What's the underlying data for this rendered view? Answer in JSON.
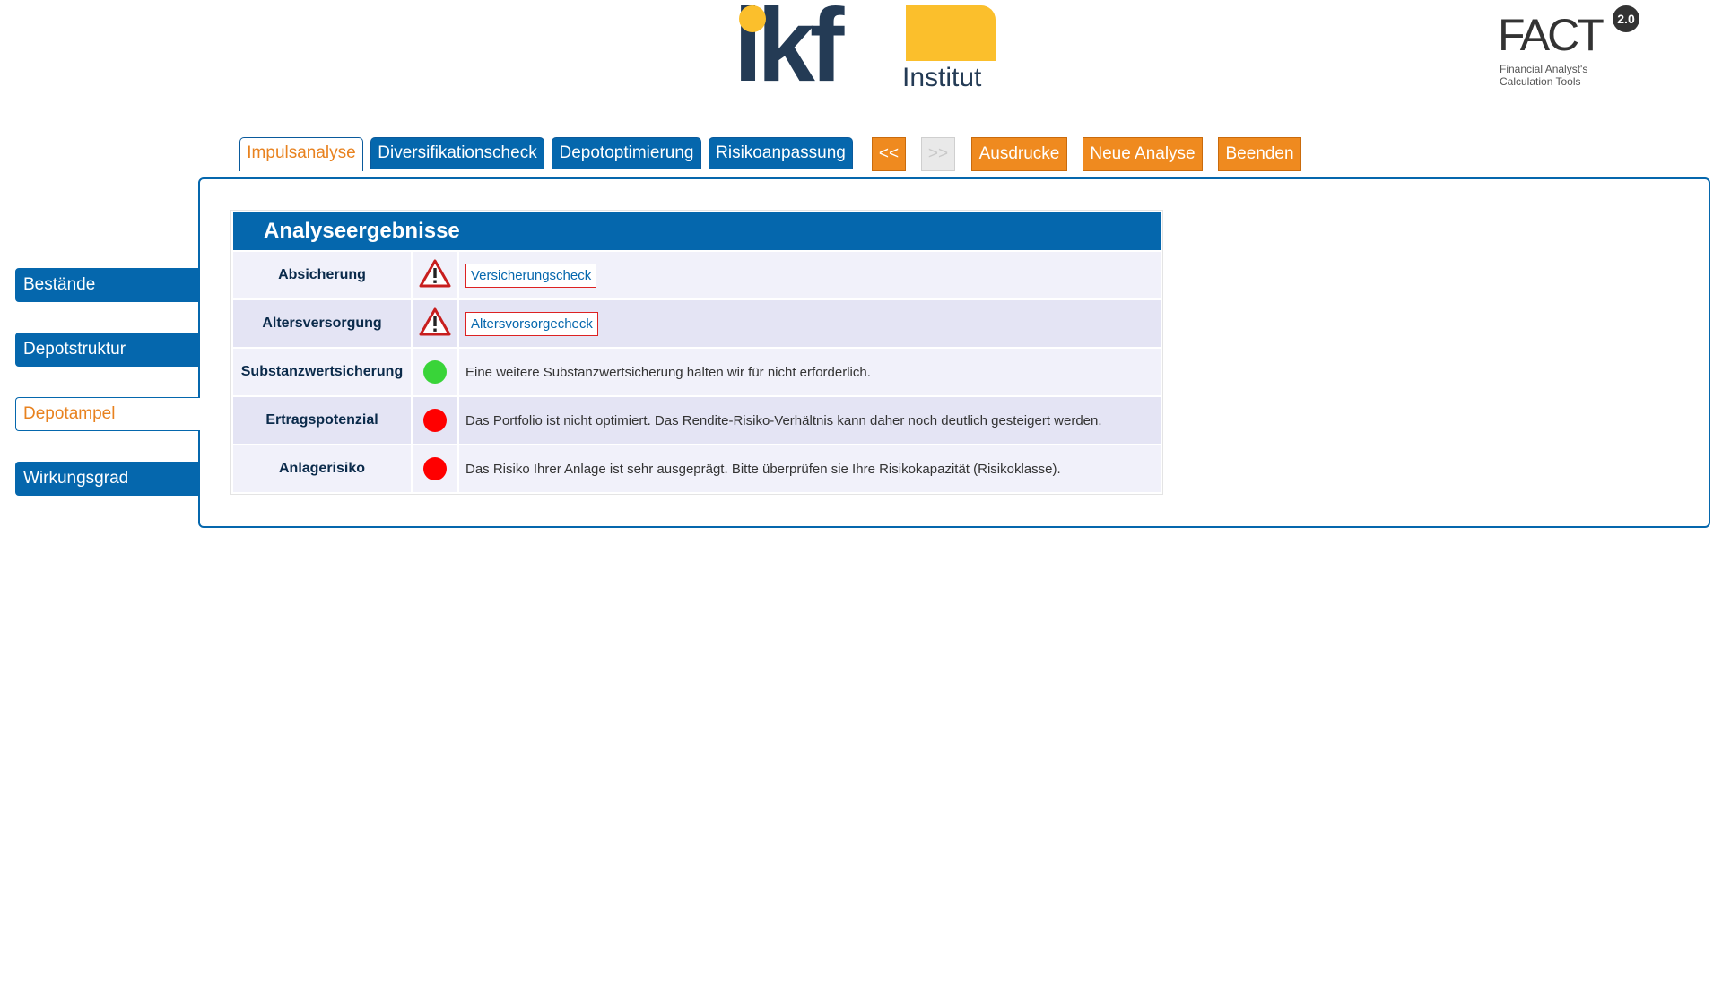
{
  "logos": {
    "ikf_letters": "ikf",
    "ikf_word": "Institut",
    "fact_name": "FACT",
    "fact_version": "2.0",
    "fact_line1": "Financial Analyst's",
    "fact_line2": "Calculation Tools"
  },
  "tabs": [
    {
      "label": "Impulsanalyse",
      "active": true
    },
    {
      "label": "Diversifikationscheck",
      "active": false
    },
    {
      "label": "Depotoptimierung",
      "active": false
    },
    {
      "label": "Risikoanpassung",
      "active": false
    }
  ],
  "actions": {
    "prev": "<<",
    "next": ">>",
    "prints": "Ausdrucke",
    "new_analysis": "Neue Analyse",
    "quit": "Beenden"
  },
  "sidebar": {
    "items": [
      {
        "label": "Bestände",
        "active": false
      },
      {
        "label": "Depotstruktur",
        "active": false
      },
      {
        "label": "Depotampel",
        "active": true
      },
      {
        "label": "Wirkungsgrad",
        "active": false
      }
    ]
  },
  "results": {
    "title": "Analyseergebnisse",
    "rows": [
      {
        "label": "Absicherung",
        "status": "warning-icon",
        "link": "Versicherungscheck"
      },
      {
        "label": "Altersversorgung",
        "status": "warning-icon",
        "link": "Altersvorsorgecheck"
      },
      {
        "label": "Substanzwertsicherung",
        "status": "green",
        "text": "Eine weitere Substanzwertsicherung halten wir für nicht erforderlich."
      },
      {
        "label": "Ertragspotenzial",
        "status": "red",
        "text": "Das Portfolio ist nicht optimiert. Das Rendite-Risiko-Verhältnis kann daher noch deutlich gesteigert werden."
      },
      {
        "label": "Anlagerisiko",
        "status": "red",
        "text": "Das Risiko Ihrer Anlage ist sehr ausgeprägt. Bitte überprüfen sie Ihre Risikokapazität (Risikoklasse)."
      }
    ]
  },
  "colors": {
    "primary": "#0567ad",
    "accent": "#ef8a1f",
    "logo_yellow": "#fbbf2c",
    "logo_navy": "#243b55"
  }
}
